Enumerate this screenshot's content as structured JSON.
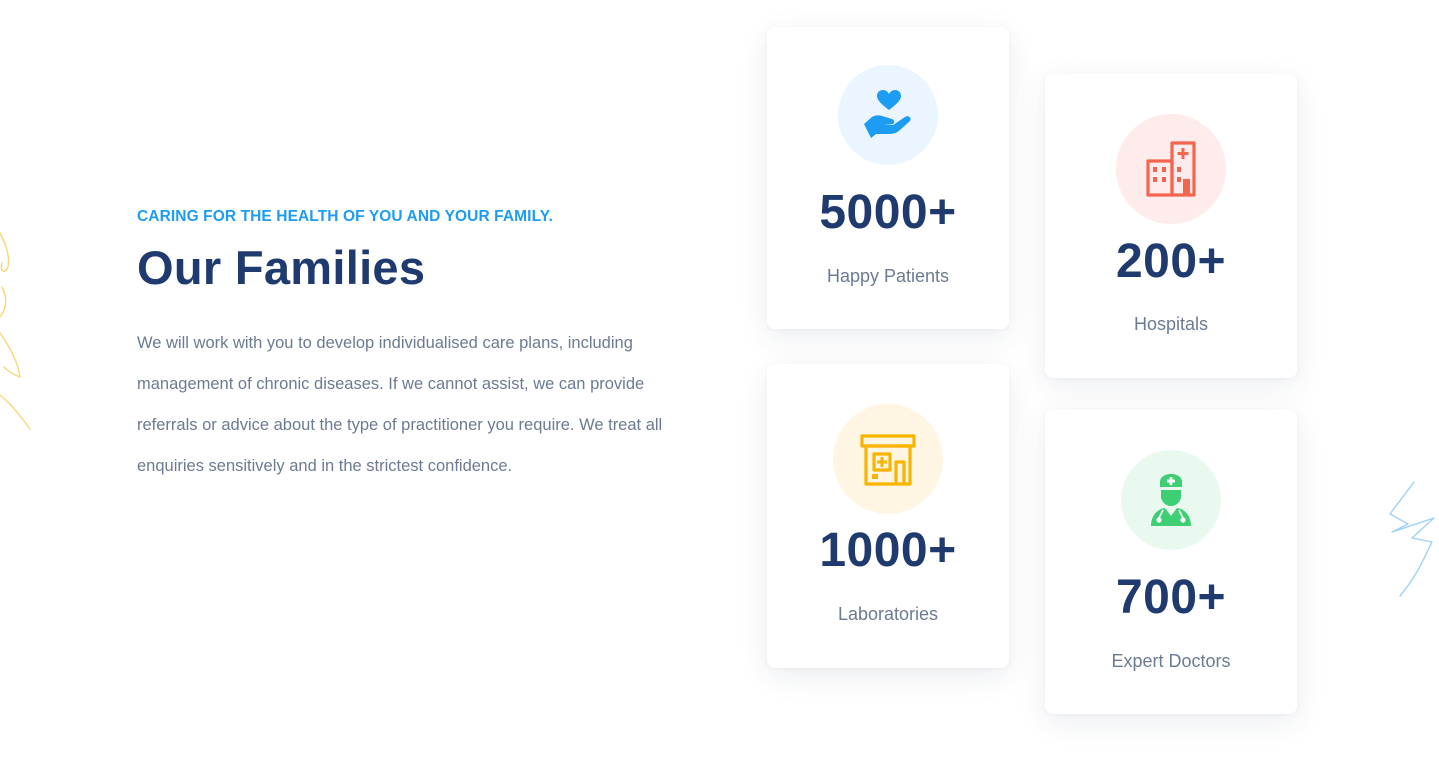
{
  "intro": {
    "subtitle": "CARING FOR THE HEALTH OF YOU AND YOUR FAMILY.",
    "title": "Our Families",
    "description": "We will work with you to develop individualised care plans, including management of chronic diseases. If we cannot assist, we can provide referrals or advice about the type of practitioner you require. We treat all enquiries sensitively and in the strictest confidence."
  },
  "stats": [
    {
      "count": "5000+",
      "label": "Happy Patients",
      "icon": "heart-hand-icon",
      "color": "#1c9cf2",
      "bg": "#eaf5ff"
    },
    {
      "count": "200+",
      "label": "Hospitals",
      "icon": "hospital-building-icon",
      "color": "#f4644f",
      "bg": "#fdeceb"
    },
    {
      "count": "1000+",
      "label": "Laboratories",
      "icon": "laboratory-building-icon",
      "color": "#f8b400",
      "bg": "#fef6e2"
    },
    {
      "count": "700+",
      "label": "Expert Doctors",
      "icon": "doctor-icon",
      "color": "#3ecf74",
      "bg": "#e9f9ef"
    }
  ],
  "decorations": {
    "left_scribble_color": "#f8d77a",
    "right_scribble_color": "#9fd1f4"
  }
}
